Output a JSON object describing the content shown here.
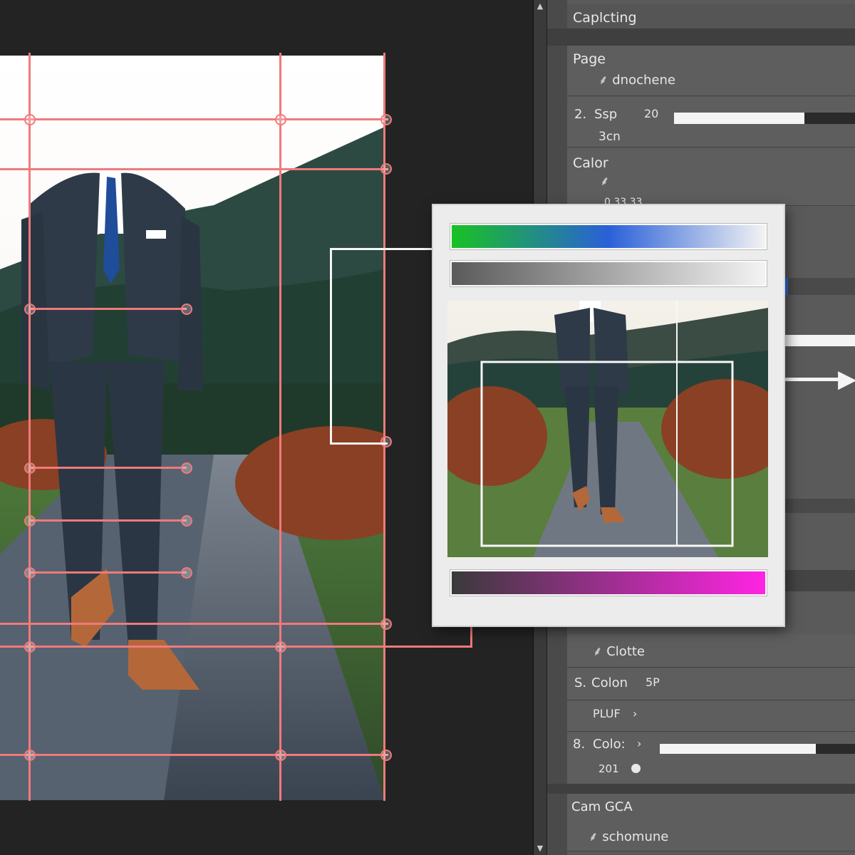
{
  "panel": {
    "title": "Caplcting",
    "page_section": {
      "label": "Page",
      "item": "dnochene"
    },
    "step_row": {
      "index": "2.",
      "label": "Ssp",
      "value": "20",
      "sub": "3cn",
      "slider_fraction": 0.72
    },
    "color_section": {
      "label": "Calor",
      "value": "0.33.33"
    },
    "clothe_row": {
      "label": "Clotte"
    },
    "color_row_5": {
      "index": "S.",
      "label": "Colon",
      "value": "5P"
    },
    "pluf_row": {
      "label": "PLUF"
    },
    "color_row_8": {
      "index": "8.",
      "label": "Colo:",
      "sub": "201",
      "slider_fraction": 0.8
    },
    "camera_section": {
      "label": "Cam GCA",
      "item": "schomune"
    }
  },
  "dialog": {
    "gradient_top": [
      "#19c223",
      "#2a60d8",
      "#f3f3f3"
    ],
    "gradient_mid": [
      "#5a5a5a",
      "#f3f3f3"
    ],
    "gradient_bottom": [
      "#3a3a3a",
      "#ff24e3"
    ]
  }
}
